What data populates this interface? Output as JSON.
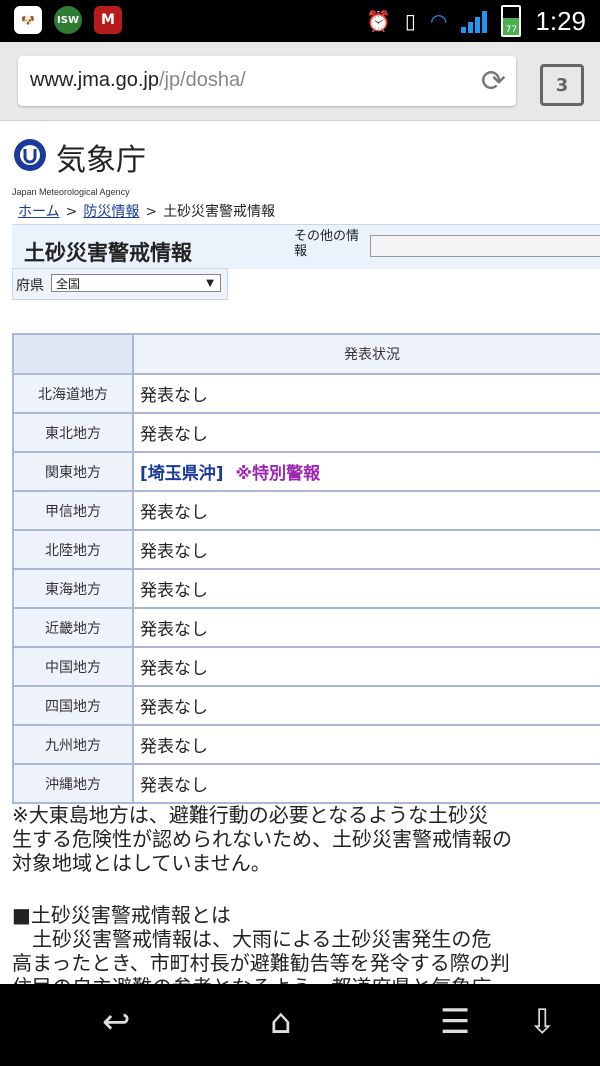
{
  "statusbar": {
    "icons": [
      "dog-icon",
      "isw-icon",
      "mcafee-icon"
    ],
    "isw_label": "ISW",
    "mc_label": "M",
    "battery": "77",
    "time": "1:29"
  },
  "browser": {
    "url_host": "www.jma.go.jp",
    "url_path": "/jp/dosha/",
    "tab_count": "3"
  },
  "site": {
    "logo_name": "気象庁",
    "logo_sub": "Japan Meteorological Agency"
  },
  "breadcrumb": {
    "home": "ホーム",
    "disaster": "防災情報",
    "current": "土砂災害警戒情報",
    "sep": ">"
  },
  "page": {
    "title": "土砂災害警戒情報",
    "other_info_label": "その他の情報",
    "pref_label": "府県",
    "pref_value": "全国"
  },
  "table": {
    "header": "発表状況",
    "rows": [
      {
        "region": "北海道地方",
        "status": "発表なし"
      },
      {
        "region": "東北地方",
        "status": "発表なし"
      },
      {
        "region": "関東地方",
        "status": "[埼玉県沖]",
        "special": "※特別警報"
      },
      {
        "region": "甲信地方",
        "status": "発表なし"
      },
      {
        "region": "北陸地方",
        "status": "発表なし"
      },
      {
        "region": "東海地方",
        "status": "発表なし"
      },
      {
        "region": "近畿地方",
        "status": "発表なし"
      },
      {
        "region": "中国地方",
        "status": "発表なし"
      },
      {
        "region": "四国地方",
        "status": "発表なし"
      },
      {
        "region": "九州地方",
        "status": "発表なし"
      },
      {
        "region": "沖縄地方",
        "status": "発表なし"
      }
    ]
  },
  "notes": {
    "line1": "※大東島地方は、避難行動の必要となるような土砂災",
    "line2": "生する危険性が認められないため、土砂災害警戒情報の",
    "line3": "対象地域とはしていません。",
    "section_title": "■土砂災害警戒情報とは",
    "section_line1": "　土砂災害警戒情報は、大雨による土砂災害発生の危",
    "section_line2": "高まったとき、市町村長が避難勧告等を発令する際の判",
    "section_line3": "住民の自主避難の参考となるよう、都道府県と気象庁"
  }
}
